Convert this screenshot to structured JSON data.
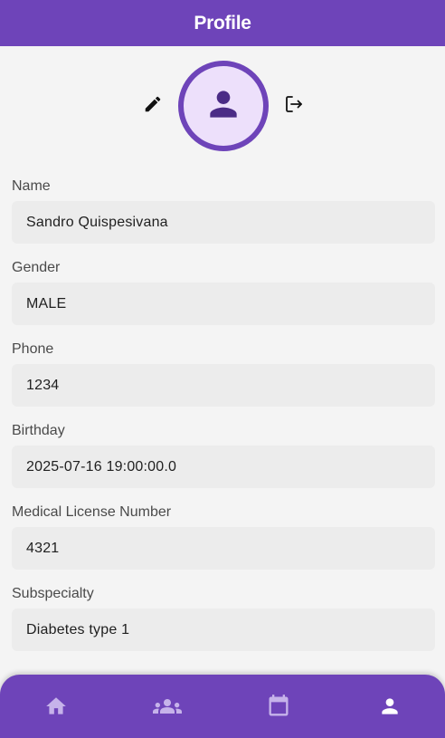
{
  "app_bar": {
    "title": "Profile"
  },
  "header": {
    "edit_icon": "pencil-icon",
    "avatar_icon": "person-icon",
    "logout_icon": "logout-icon"
  },
  "fields": [
    {
      "label": "Name",
      "value": "Sandro Quispesivana"
    },
    {
      "label": "Gender",
      "value": "MALE"
    },
    {
      "label": "Phone",
      "value": "1234"
    },
    {
      "label": "Birthday",
      "value": "2025-07-16 19:00:00.0"
    },
    {
      "label": "Medical License Number",
      "value": "4321"
    },
    {
      "label": "Subspecialty",
      "value": "Diabetes type 1"
    }
  ],
  "bottom_nav": {
    "items": [
      {
        "icon": "home-icon",
        "active": false
      },
      {
        "icon": "groups-icon",
        "active": false
      },
      {
        "icon": "calendar-icon",
        "active": false
      },
      {
        "icon": "person-icon",
        "active": true
      }
    ]
  },
  "colors": {
    "primary": "#6e44b9",
    "avatar_bg": "#ede0fb",
    "nav_inactive": "#c6b3ea",
    "nav_active": "#ffffff"
  }
}
